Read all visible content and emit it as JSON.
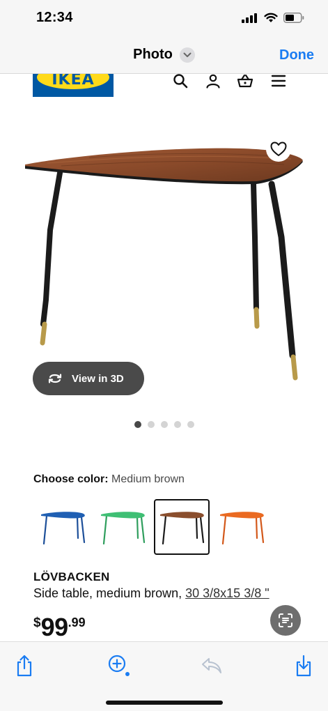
{
  "status_bar": {
    "time": "12:34",
    "icons": [
      "cellular-signal-icon",
      "wifi-icon",
      "battery-icon"
    ]
  },
  "nav": {
    "title": "Photo",
    "done_label": "Done",
    "accent_color": "#1a7cf2"
  },
  "site_header": {
    "logo_text": "IKEA",
    "brand_colors": {
      "blue": "#0058a3",
      "yellow": "#ffda1a"
    },
    "icons": [
      "search-icon",
      "account-icon",
      "cart-icon",
      "menu-icon"
    ]
  },
  "gallery": {
    "view3d_label": "View in 3D",
    "dot_count": 5,
    "active_dot": 0
  },
  "color_picker": {
    "label": "Choose color:",
    "selected_value": "Medium brown",
    "swatches": [
      {
        "color": "#1f5fb3",
        "selected": false
      },
      {
        "color": "#3fbf74",
        "selected": false
      },
      {
        "color": "#8a4e2d",
        "selected": true
      },
      {
        "color": "#ea6a21",
        "selected": false
      }
    ]
  },
  "product": {
    "name": "LÖVBACKEN",
    "description": "Side table, medium brown,",
    "size": "30 3/8x15 3/8 \"",
    "price_currency": "$",
    "price_int": "99",
    "price_dec": ".99"
  },
  "toolbar": {
    "icons": [
      "share-icon",
      "zoom-in-icon",
      "reply-icon",
      "save-icon"
    ]
  }
}
